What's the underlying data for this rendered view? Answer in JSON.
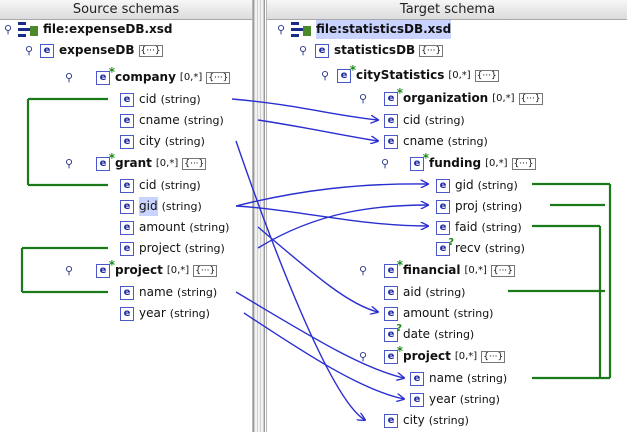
{
  "left": {
    "header": "Source schemas",
    "file": "file:expenseDB.xsd",
    "root": "expenseDB",
    "company": {
      "name": "company",
      "card": "[0,*]"
    },
    "company_fields": [
      {
        "name": "cid",
        "type": "(string)"
      },
      {
        "name": "cname",
        "type": "(string)"
      },
      {
        "name": "city",
        "type": "(string)"
      }
    ],
    "grant": {
      "name": "grant",
      "card": "[0,*]"
    },
    "grant_fields": [
      {
        "name": "cid",
        "type": "(string)"
      },
      {
        "name": "gid",
        "type": "(string)"
      },
      {
        "name": "amount",
        "type": "(string)"
      },
      {
        "name": "project",
        "type": "(string)"
      }
    ],
    "project": {
      "name": "project",
      "card": "[0,*]"
    },
    "project_fields": [
      {
        "name": "name",
        "type": "(string)"
      },
      {
        "name": "year",
        "type": "(string)"
      }
    ]
  },
  "right": {
    "header": "Target schema",
    "file": "file:statisticsDB.xsd",
    "root": "statisticsDB",
    "cityStatistics": {
      "name": "cityStatistics",
      "card": "[0,*]"
    },
    "organization": {
      "name": "organization",
      "card": "[0,*]"
    },
    "organization_fields": [
      {
        "name": "cid",
        "type": "(string)"
      },
      {
        "name": "cname",
        "type": "(string)"
      }
    ],
    "funding": {
      "name": "funding",
      "card": "[0,*]"
    },
    "funding_fields": [
      {
        "name": "gid",
        "type": "(string)"
      },
      {
        "name": "proj",
        "type": "(string)"
      },
      {
        "name": "faid",
        "type": "(string)"
      },
      {
        "name": "recv",
        "type": "(string)"
      }
    ],
    "financial": {
      "name": "financial",
      "card": "[0,*]"
    },
    "financial_fields": [
      {
        "name": "aid",
        "type": "(string)"
      },
      {
        "name": "amount",
        "type": "(string)"
      },
      {
        "name": "date",
        "type": "(string)"
      }
    ],
    "project": {
      "name": "project",
      "card": "[0,*]"
    },
    "project_fields": [
      {
        "name": "name",
        "type": "(string)"
      },
      {
        "name": "year",
        "type": "(string)"
      }
    ],
    "city": {
      "name": "city",
      "type": "(string)"
    }
  },
  "icons": {
    "element": "e",
    "dots": "{···}"
  },
  "colors": {
    "mapping_line": "#2a2fd0",
    "constraint_line": "#1a7a1a",
    "highlight": "#c9d3ff"
  }
}
